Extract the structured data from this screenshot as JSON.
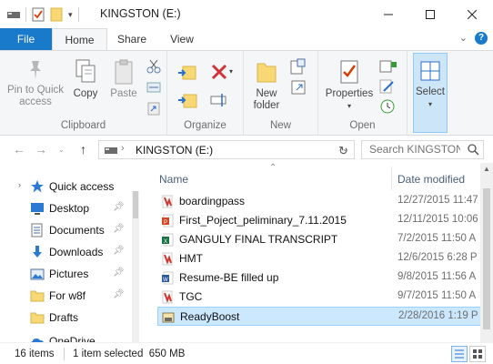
{
  "window": {
    "title": "KINGSTON (E:)"
  },
  "tabs": [
    {
      "label": "File"
    },
    {
      "label": "Home"
    },
    {
      "label": "Share"
    },
    {
      "label": "View"
    }
  ],
  "ribbon": {
    "clipboard": {
      "group_label": "Clipboard",
      "pin_label": "Pin to Quick access",
      "copy_label": "Copy",
      "paste_label": "Paste"
    },
    "organize": {
      "group_label": "Organize"
    },
    "new": {
      "group_label": "New",
      "new_folder_label": "New folder"
    },
    "open": {
      "group_label": "Open",
      "properties_label": "Properties"
    },
    "select": {
      "select_label": "Select"
    }
  },
  "address": {
    "path": "KINGSTON (E:)",
    "search_placeholder": "Search KINGSTON (E:)"
  },
  "nav": {
    "items": [
      {
        "label": "Quick access",
        "icon": "star-icon"
      },
      {
        "label": "Desktop",
        "icon": "desktop-icon",
        "pinned": true
      },
      {
        "label": "Documents",
        "icon": "documents-icon",
        "pinned": true
      },
      {
        "label": "Downloads",
        "icon": "downloads-icon",
        "pinned": true
      },
      {
        "label": "Pictures",
        "icon": "pictures-icon",
        "pinned": true
      },
      {
        "label": "For w8f",
        "icon": "folder-icon",
        "pinned": true
      },
      {
        "label": "Drafts",
        "icon": "folder-icon"
      },
      {
        "label": "OneDrive",
        "icon": "cloud-icon"
      }
    ]
  },
  "filelist": {
    "col_name": "Name",
    "col_date": "Date modified",
    "rows": [
      {
        "name": "boardingpass",
        "date": "12/27/2015 11:47",
        "icon": "pdf-icon"
      },
      {
        "name": "First_Poject_peliminary_7.11.2015",
        "date": "12/11/2015 10:06",
        "icon": "ppt-icon"
      },
      {
        "name": "GANGULY FINAL TRANSCRIPT",
        "date": "7/2/2015 11:50 A",
        "icon": "excel-icon"
      },
      {
        "name": "HMT",
        "date": "12/6/2015 6:28 P",
        "icon": "pdf-icon"
      },
      {
        "name": "Resume-BE filled up",
        "date": "9/8/2015 11:56 A",
        "icon": "word-icon"
      },
      {
        "name": "TGC",
        "date": "9/7/2015 11:50 A",
        "icon": "pdf-icon"
      },
      {
        "name": "ReadyBoost",
        "date": "2/28/2016 1:19 P",
        "icon": "readyboost-icon",
        "selected": true
      }
    ]
  },
  "status": {
    "count": "16 items",
    "selection": "1 item selected  650 MB"
  },
  "colors": {
    "accent": "#1979ca",
    "selection_bg": "#cce8ff",
    "ribbon_bg": "#f5f6f7"
  }
}
